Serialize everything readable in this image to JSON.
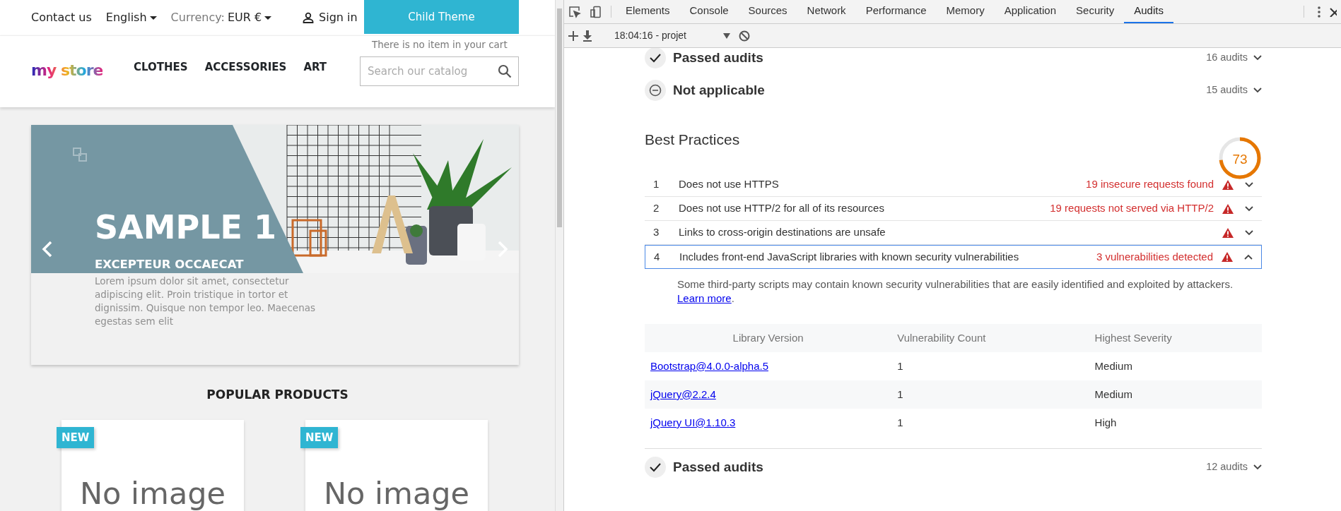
{
  "store": {
    "top_bar": {
      "contact": "Contact us",
      "language": "English",
      "currency_label": "Currency:",
      "currency": "EUR €",
      "sign_in": "Sign in",
      "theme_button": "Child Theme",
      "cart_message": "There is no item in your cart"
    },
    "logo": "my store",
    "menu": [
      "CLOTHES",
      "ACCESSORIES",
      "ART"
    ],
    "search": {
      "placeholder": "Search our catalog"
    },
    "slide": {
      "title": "SAMPLE 1",
      "subtitle": "EXCEPTEUR OCCAECAT",
      "text": "Lorem ipsum dolor sit amet, consectetur adipiscing elit. Proin tristique in tortor et dignissim. Quisque non tempor leo. Maecenas egestas sem elit"
    },
    "section_title": "POPULAR PRODUCTS",
    "products": [
      {
        "badge": "NEW",
        "image_text": "No image"
      },
      {
        "badge": "NEW",
        "image_text": "No image"
      }
    ]
  },
  "devtools": {
    "tabs": [
      {
        "label": "Elements",
        "selected": false
      },
      {
        "label": "Console",
        "selected": false
      },
      {
        "label": "Sources",
        "selected": false
      },
      {
        "label": "Network",
        "selected": false
      },
      {
        "label": "Performance",
        "selected": false
      },
      {
        "label": "Memory",
        "selected": false
      },
      {
        "label": "Application",
        "selected": false
      },
      {
        "label": "Security",
        "selected": false
      },
      {
        "label": "Audits",
        "selected": true
      }
    ],
    "report": "18:04:16 - projet",
    "groups_top": [
      {
        "kind": "passed",
        "title": "Passed audits",
        "count": "16 audits"
      },
      {
        "kind": "not_applicable",
        "title": "Not applicable",
        "count": "15 audits"
      }
    ],
    "category": {
      "title": "Best Practices",
      "score": "73",
      "level": 0.73
    },
    "audits": [
      {
        "index": "1",
        "title": "Does not use HTTPS",
        "result": "19 insecure requests found",
        "expanded": false
      },
      {
        "index": "2",
        "title": "Does not use HTTP/2 for all of its resources",
        "result": "19 requests not served via HTTP/2",
        "expanded": false
      },
      {
        "index": "3",
        "title": "Links to cross-origin destinations are unsafe",
        "expanded": false
      },
      {
        "index": "4",
        "title": "Includes front-end JavaScript libraries with known security vulnerabilities",
        "result": "3 vulnerabilities detected",
        "expanded": true
      }
    ],
    "details": {
      "description": "Some third-party scripts may contain known security vulnerabilities that are easily identified and exploited by attackers.",
      "link": "Learn more",
      "description_end": ".",
      "columns": [
        "Library Version",
        "Vulnerability Count",
        "Highest Severity"
      ],
      "rows": [
        {
          "library": "Bootstrap@4.0.0-alpha.5",
          "count": "1",
          "severity": "Medium"
        },
        {
          "library": "jQuery@2.2.4",
          "count": "1",
          "severity": "Medium"
        },
        {
          "library": "jQuery UI@1.10.3",
          "count": "1",
          "severity": "High"
        }
      ]
    },
    "groups_bottom": [
      {
        "kind": "passed",
        "title": "Passed audits",
        "count": "12 audits"
      }
    ]
  }
}
